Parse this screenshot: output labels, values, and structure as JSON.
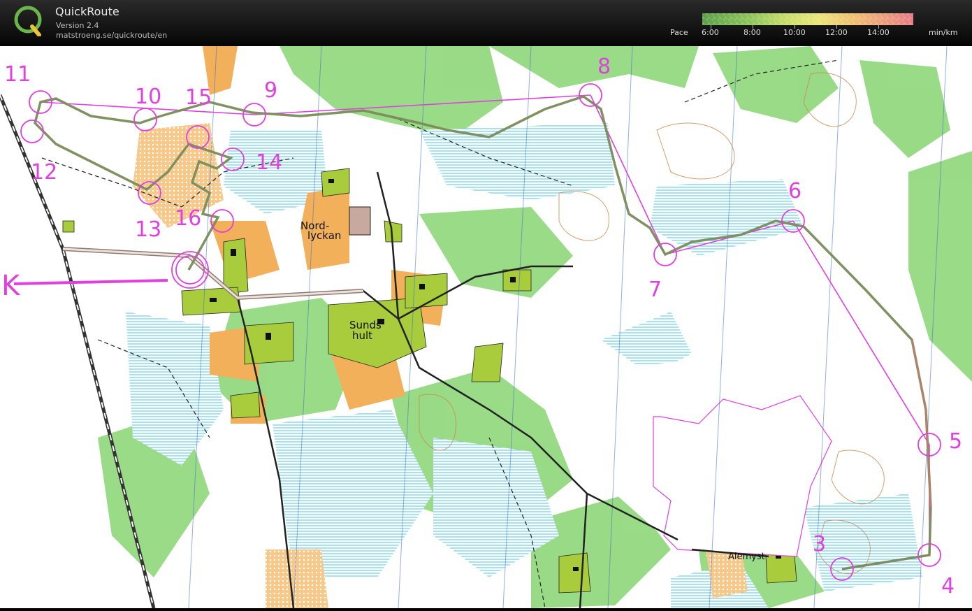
{
  "app": {
    "title": "QuickRoute",
    "version": "Version 2.4",
    "url": "matstroeng.se/quickroute/en"
  },
  "pace_scale": {
    "label": "Pace",
    "unit": "min/km",
    "ticks": [
      "6:00",
      "8:00",
      "10:00",
      "12:00",
      "14:00"
    ]
  },
  "map": {
    "place_names": [
      "Nord-",
      "lyckan",
      "Sunds",
      "hult",
      "Alemyst"
    ],
    "start_label": "K",
    "control_labels": [
      "3",
      "4",
      "5",
      "6",
      "7",
      "8",
      "9",
      "10",
      "11",
      "12",
      "13",
      "14",
      "15",
      "16"
    ],
    "colors": {
      "course": "#e040e0",
      "route": "#7a8c5a",
      "forest_green": "#7fd36a",
      "field_yellow": "#f2b05a",
      "settlement": "#a8cc3c",
      "water_blue": "#7fd8e8"
    }
  }
}
